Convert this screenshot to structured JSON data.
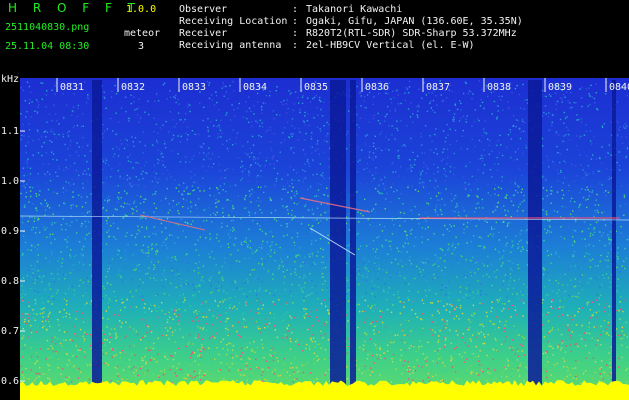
{
  "app": {
    "title": "H R O F F T",
    "version": "1.0.0"
  },
  "file": {
    "name": "2511040830.png",
    "datetime": "25.11.04 08:30"
  },
  "detection": {
    "label": "meteor",
    "count": "3"
  },
  "info": [
    {
      "key": "Observer",
      "value": "Takanori Kawachi"
    },
    {
      "key": "Receiving Location",
      "value": "Ogaki, Gifu, JAPAN (136.60E, 35.35N)"
    },
    {
      "key": "Receiver",
      "value": "R820T2(RTL-SDR) SDR-Sharp 53.372MHz"
    },
    {
      "key": "Receiving antenna",
      "value": "2el-HB9CV Vertical (el. E-W)"
    }
  ],
  "axis": {
    "unit": "kHz",
    "y_ticks": [
      "1.1",
      "1.0",
      "0.9",
      "0.8",
      "0.7",
      "0.6"
    ],
    "time_ticks": [
      "0831",
      "0832",
      "0833",
      "0834",
      "0835",
      "0836",
      "0837",
      "0838",
      "0839",
      "0840"
    ]
  },
  "colors": {
    "label": "#22ee22",
    "header": "#f2f2f2",
    "version": "#ffff00",
    "floor": "#ffff00",
    "background": "#1b2fd0"
  }
}
